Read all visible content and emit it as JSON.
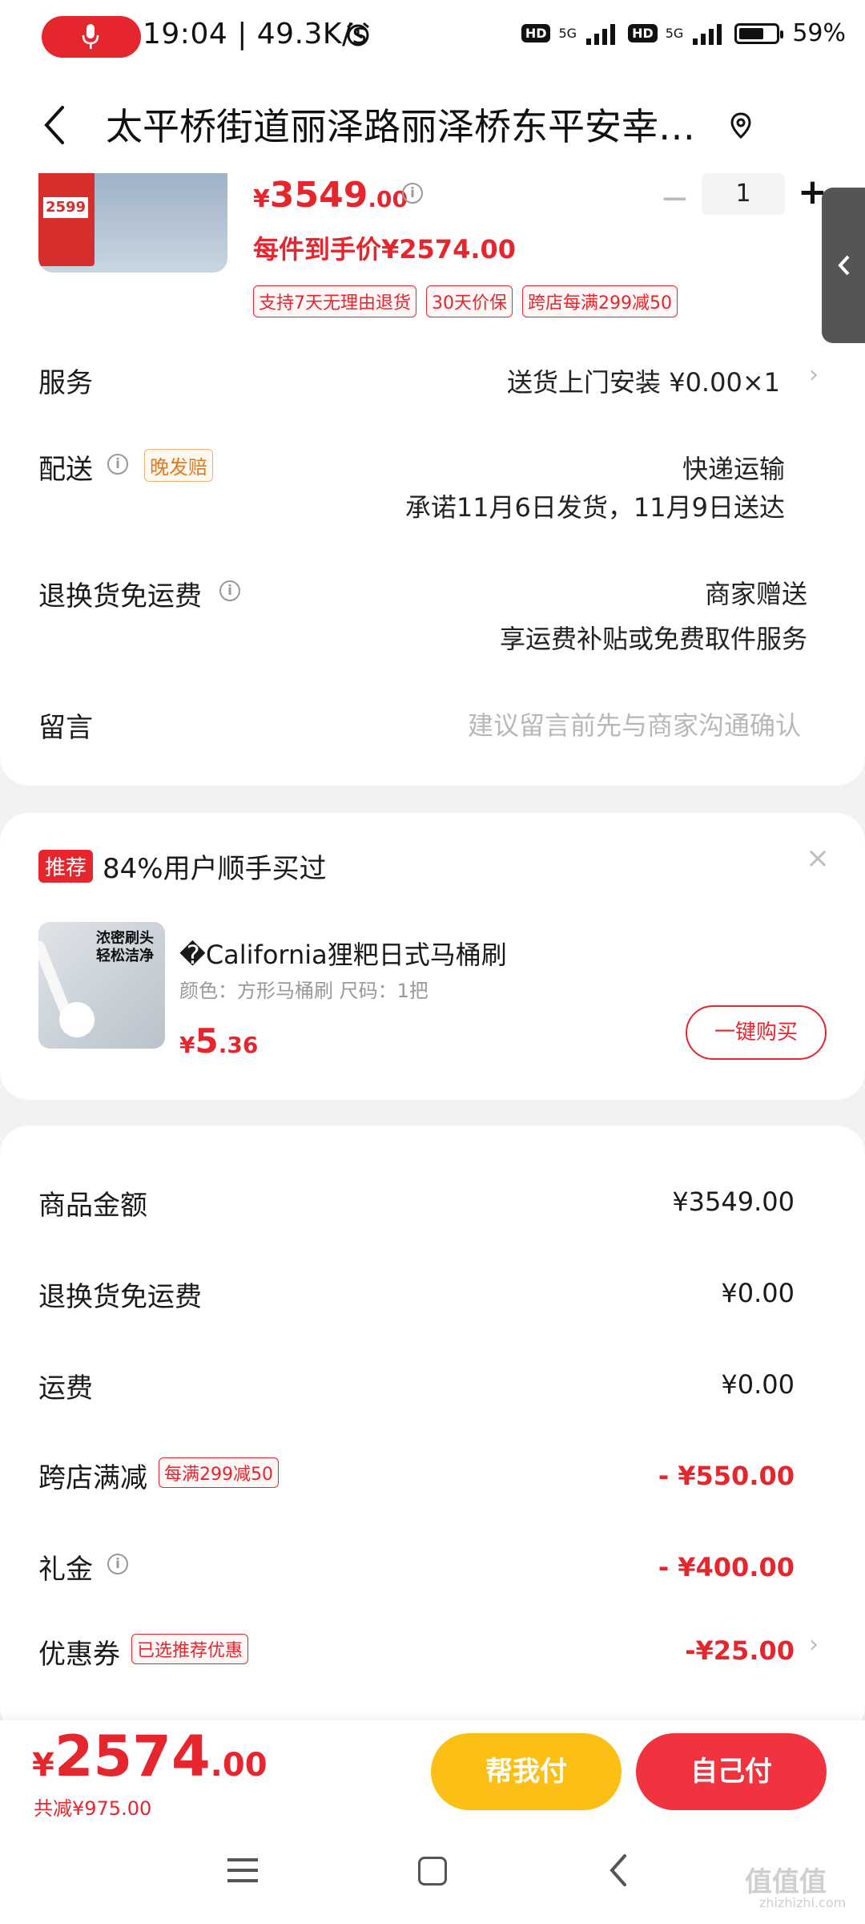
{
  "status_bar": {
    "time": "19:04 | 49.3K/s",
    "net1": "5G",
    "net2": "5G",
    "battery": "59%"
  },
  "header": {
    "address": "太平桥街道丽泽路丽泽桥东平安幸…"
  },
  "product": {
    "thumb_price": "2599",
    "price_symbol": "¥",
    "price_int": "3549",
    "price_dec": ".00",
    "qty_minus": "−",
    "quantity": "1",
    "qty_plus": "+",
    "per_item_price": "每件到手价¥2574.00",
    "tags": [
      "支持7天无理由退货",
      "30天价保",
      "跨店每满299减50"
    ]
  },
  "service": {
    "label": "服务",
    "value": "送货上门安装  ¥0.00×1"
  },
  "delivery": {
    "label": "配送",
    "badge": "晚发赔",
    "method": "快递运输",
    "promise": "承诺11月6日发货，11月9日送达"
  },
  "return_shipping": {
    "label": "退换货免运费",
    "value1": "商家赠送",
    "value2": "享运费补贴或免费取件服务"
  },
  "message": {
    "label": "留言",
    "placeholder": "建议留言前先与商家沟通确认"
  },
  "recommend": {
    "badge": "推荐",
    "title": "84%用户顺手买过",
    "close": "×",
    "thumb_text": "浓密刷头 轻松洁净",
    "name": "�California狸粑日式马桶刷",
    "spec": "颜色：方形马桶刷    尺码：1把",
    "price_symbol": "¥",
    "price_int": "5",
    "price_dec": ".36",
    "buy_label": "一键购买"
  },
  "summary": {
    "rows": [
      {
        "label": "商品金额",
        "value": "¥3549.00"
      },
      {
        "label": "退换货免运费",
        "value": "¥0.00"
      },
      {
        "label": "运费",
        "value": "¥0.00"
      },
      {
        "label": "跨店满减",
        "tag": "每满299减50",
        "value": "- ¥550.00"
      },
      {
        "label": "礼金",
        "value": "- ¥400.00"
      },
      {
        "label": "优惠券",
        "tag": "已选推荐优惠",
        "value": "-¥25.00"
      }
    ]
  },
  "bottom": {
    "total_symbol": "¥",
    "total_int": "2574",
    "total_dec": ".00",
    "saved": "共减¥975.00",
    "help_pay": "帮我付",
    "self_pay": "自己付"
  },
  "watermark": {
    "text": "值值值",
    "url": "zhizhizhi.com"
  },
  "colors": {
    "accent": "#e5262e",
    "yellow": "#fbbf16",
    "button_red": "#f0333f"
  }
}
